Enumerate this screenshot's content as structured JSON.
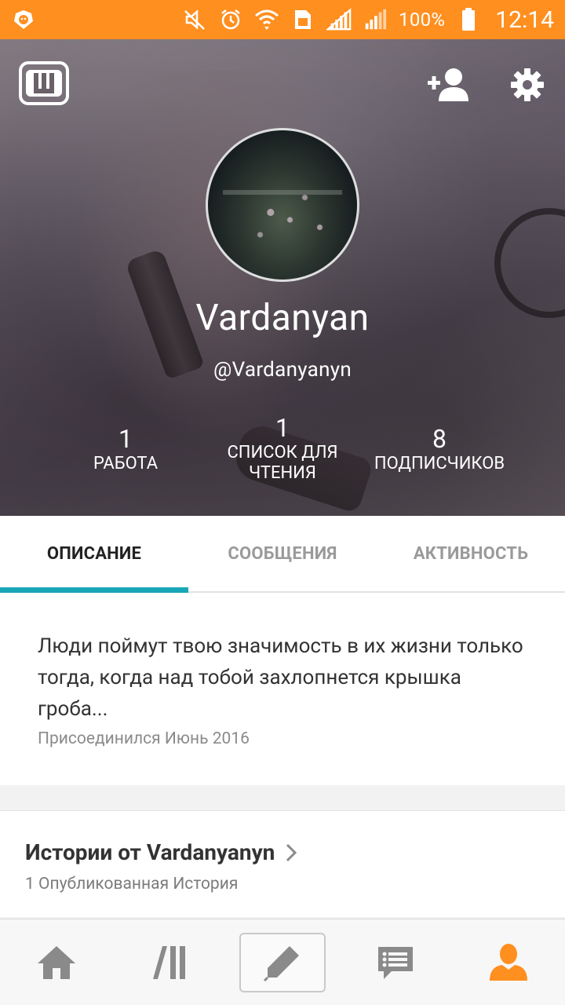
{
  "status_bar": {
    "battery": "100%",
    "time": "12:14",
    "icons": [
      "lion-app-icon",
      "mute-icon",
      "alarm-icon",
      "wifi-icon",
      "sim-icon",
      "signal-icon",
      "signal-icon-2",
      "battery-icon"
    ]
  },
  "header": {
    "logo_icon": "wattpad-logo-icon",
    "follow_icon": "add-user-icon",
    "settings_icon": "gear-icon"
  },
  "profile": {
    "display_name": "Vardanyan",
    "username": "@Vardanyanyn",
    "stats": [
      {
        "value": "1",
        "label": "РАБОТА"
      },
      {
        "value": "1",
        "label": "СПИСОК ДЛЯ ЧТЕНИЯ"
      },
      {
        "value": "8",
        "label": "ПОДПИСЧИКОВ"
      }
    ]
  },
  "tabs": [
    {
      "label": "ОПИСАНИЕ",
      "active": true
    },
    {
      "label": "СООБЩЕНИЯ",
      "active": false
    },
    {
      "label": "АКТИВНОСТЬ",
      "active": false
    }
  ],
  "about": {
    "description": "Люди поймут твою значимость в их жизни только тогда, когда над тобой захлопнется крышка гроба...",
    "joined": "Присоединился Июнь 2016"
  },
  "stories": {
    "title": "Истории от Vardanyanyn",
    "subtitle": "1 Опубликованная История"
  },
  "bottom_nav": [
    {
      "icon": "home-icon"
    },
    {
      "icon": "library-icon"
    },
    {
      "icon": "pencil-icon"
    },
    {
      "icon": "messages-icon"
    },
    {
      "icon": "profile-icon",
      "active": true
    }
  ],
  "colors": {
    "status_bar": "#ff8f1f",
    "tab_indicator": "#19a7b8",
    "active_nav": "#ff8f1f",
    "inactive_nav": "#8a8a8a"
  }
}
